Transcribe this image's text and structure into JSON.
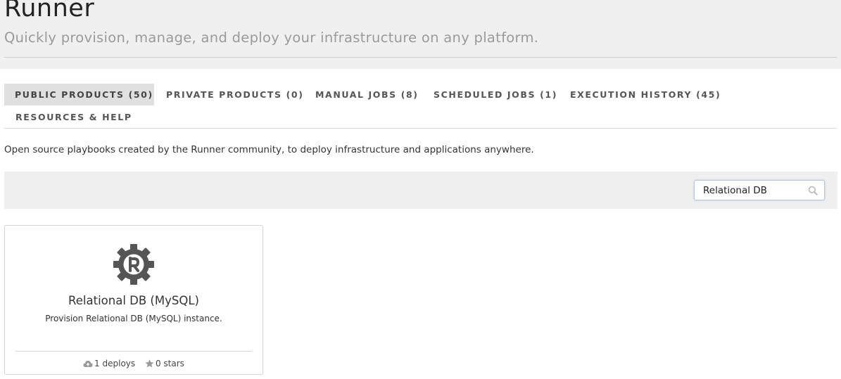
{
  "header": {
    "title": "Runner",
    "subtitle": "Quickly provision, manage, and deploy your infrastructure on any platform."
  },
  "tabs": [
    {
      "label": "PUBLIC PRODUCTS (50)",
      "active": true
    },
    {
      "label": "PRIVATE PRODUCTS (0)",
      "active": false
    },
    {
      "label": "MANUAL JOBS (8)",
      "active": false
    },
    {
      "label": "SCHEDULED JOBS (1)",
      "active": false
    },
    {
      "label": "EXECUTION HISTORY (45)",
      "active": false
    },
    {
      "label": "RESOURCES & HELP",
      "active": false
    }
  ],
  "intro": "Open source playbooks created by the Runner community, to deploy infrastructure and applications anywhere.",
  "search": {
    "value": "Relational DB",
    "icon": "search-icon"
  },
  "products": [
    {
      "icon": "runner-gear-logo-icon",
      "name": "Relational DB (MySQL)",
      "description": "Provision Relational DB (MySQL) instance.",
      "deploys": "1 deploys",
      "stars": "0 stars"
    }
  ],
  "colors": {
    "header_bg": "#f0f0f0",
    "active_tab_bg": "#e0e0e0",
    "filter_bar_bg": "#efefef",
    "logo": "#555555",
    "search_border": "#b7c8df"
  }
}
